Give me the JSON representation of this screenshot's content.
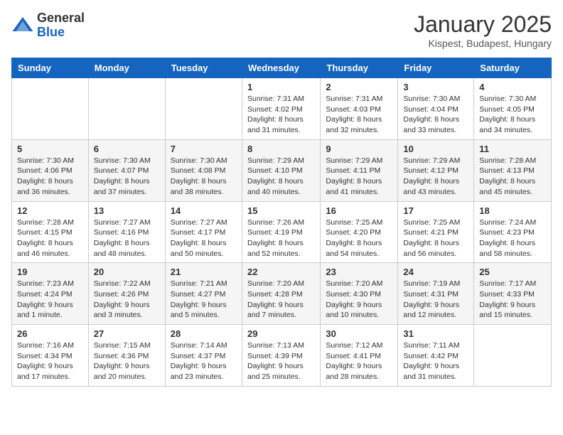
{
  "header": {
    "logo_general": "General",
    "logo_blue": "Blue",
    "month_year": "January 2025",
    "location": "Kispest, Budapest, Hungary"
  },
  "days_of_week": [
    "Sunday",
    "Monday",
    "Tuesday",
    "Wednesday",
    "Thursday",
    "Friday",
    "Saturday"
  ],
  "weeks": [
    [
      {
        "day": "",
        "info": ""
      },
      {
        "day": "",
        "info": ""
      },
      {
        "day": "",
        "info": ""
      },
      {
        "day": "1",
        "info": "Sunrise: 7:31 AM\nSunset: 4:02 PM\nDaylight: 8 hours and 31 minutes."
      },
      {
        "day": "2",
        "info": "Sunrise: 7:31 AM\nSunset: 4:03 PM\nDaylight: 8 hours and 32 minutes."
      },
      {
        "day": "3",
        "info": "Sunrise: 7:30 AM\nSunset: 4:04 PM\nDaylight: 8 hours and 33 minutes."
      },
      {
        "day": "4",
        "info": "Sunrise: 7:30 AM\nSunset: 4:05 PM\nDaylight: 8 hours and 34 minutes."
      }
    ],
    [
      {
        "day": "5",
        "info": "Sunrise: 7:30 AM\nSunset: 4:06 PM\nDaylight: 8 hours and 36 minutes."
      },
      {
        "day": "6",
        "info": "Sunrise: 7:30 AM\nSunset: 4:07 PM\nDaylight: 8 hours and 37 minutes."
      },
      {
        "day": "7",
        "info": "Sunrise: 7:30 AM\nSunset: 4:08 PM\nDaylight: 8 hours and 38 minutes."
      },
      {
        "day": "8",
        "info": "Sunrise: 7:29 AM\nSunset: 4:10 PM\nDaylight: 8 hours and 40 minutes."
      },
      {
        "day": "9",
        "info": "Sunrise: 7:29 AM\nSunset: 4:11 PM\nDaylight: 8 hours and 41 minutes."
      },
      {
        "day": "10",
        "info": "Sunrise: 7:29 AM\nSunset: 4:12 PM\nDaylight: 8 hours and 43 minutes."
      },
      {
        "day": "11",
        "info": "Sunrise: 7:28 AM\nSunset: 4:13 PM\nDaylight: 8 hours and 45 minutes."
      }
    ],
    [
      {
        "day": "12",
        "info": "Sunrise: 7:28 AM\nSunset: 4:15 PM\nDaylight: 8 hours and 46 minutes."
      },
      {
        "day": "13",
        "info": "Sunrise: 7:27 AM\nSunset: 4:16 PM\nDaylight: 8 hours and 48 minutes."
      },
      {
        "day": "14",
        "info": "Sunrise: 7:27 AM\nSunset: 4:17 PM\nDaylight: 8 hours and 50 minutes."
      },
      {
        "day": "15",
        "info": "Sunrise: 7:26 AM\nSunset: 4:19 PM\nDaylight: 8 hours and 52 minutes."
      },
      {
        "day": "16",
        "info": "Sunrise: 7:25 AM\nSunset: 4:20 PM\nDaylight: 8 hours and 54 minutes."
      },
      {
        "day": "17",
        "info": "Sunrise: 7:25 AM\nSunset: 4:21 PM\nDaylight: 8 hours and 56 minutes."
      },
      {
        "day": "18",
        "info": "Sunrise: 7:24 AM\nSunset: 4:23 PM\nDaylight: 8 hours and 58 minutes."
      }
    ],
    [
      {
        "day": "19",
        "info": "Sunrise: 7:23 AM\nSunset: 4:24 PM\nDaylight: 9 hours and 1 minute."
      },
      {
        "day": "20",
        "info": "Sunrise: 7:22 AM\nSunset: 4:26 PM\nDaylight: 9 hours and 3 minutes."
      },
      {
        "day": "21",
        "info": "Sunrise: 7:21 AM\nSunset: 4:27 PM\nDaylight: 9 hours and 5 minutes."
      },
      {
        "day": "22",
        "info": "Sunrise: 7:20 AM\nSunset: 4:28 PM\nDaylight: 9 hours and 7 minutes."
      },
      {
        "day": "23",
        "info": "Sunrise: 7:20 AM\nSunset: 4:30 PM\nDaylight: 9 hours and 10 minutes."
      },
      {
        "day": "24",
        "info": "Sunrise: 7:19 AM\nSunset: 4:31 PM\nDaylight: 9 hours and 12 minutes."
      },
      {
        "day": "25",
        "info": "Sunrise: 7:17 AM\nSunset: 4:33 PM\nDaylight: 9 hours and 15 minutes."
      }
    ],
    [
      {
        "day": "26",
        "info": "Sunrise: 7:16 AM\nSunset: 4:34 PM\nDaylight: 9 hours and 17 minutes."
      },
      {
        "day": "27",
        "info": "Sunrise: 7:15 AM\nSunset: 4:36 PM\nDaylight: 9 hours and 20 minutes."
      },
      {
        "day": "28",
        "info": "Sunrise: 7:14 AM\nSunset: 4:37 PM\nDaylight: 9 hours and 23 minutes."
      },
      {
        "day": "29",
        "info": "Sunrise: 7:13 AM\nSunset: 4:39 PM\nDaylight: 9 hours and 25 minutes."
      },
      {
        "day": "30",
        "info": "Sunrise: 7:12 AM\nSunset: 4:41 PM\nDaylight: 9 hours and 28 minutes."
      },
      {
        "day": "31",
        "info": "Sunrise: 7:11 AM\nSunset: 4:42 PM\nDaylight: 9 hours and 31 minutes."
      },
      {
        "day": "",
        "info": ""
      }
    ]
  ]
}
